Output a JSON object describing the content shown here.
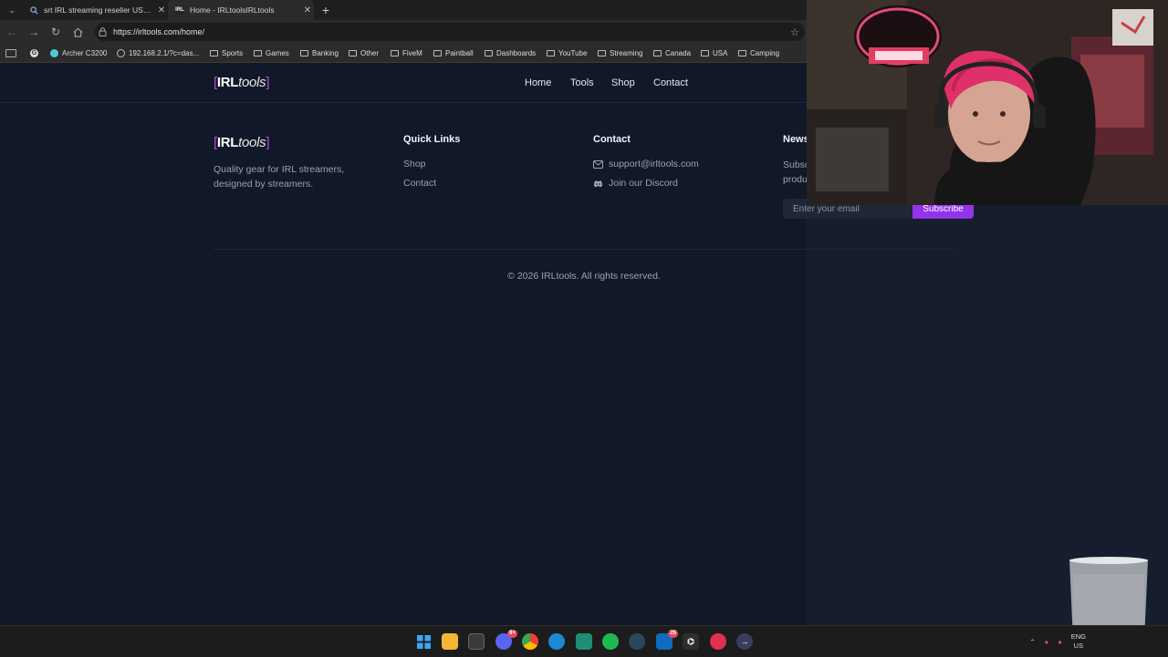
{
  "browser": {
    "tabs": [
      {
        "title": "srt IRL streaming reseller USA - Se",
        "icon": "search-icon",
        "active": false
      },
      {
        "title": "Home - IRLtoolsIRLtools",
        "icon": "irl-favicon",
        "active": true
      }
    ],
    "new_tab": "+",
    "url": "https://irltools.com/home/",
    "bookmarks": [
      {
        "label": "Archer C3200",
        "icon": "tp-link-icon"
      },
      {
        "label": "192.168.2.1/?c=das...",
        "icon": "globe-icon"
      },
      {
        "label": "Sports",
        "icon": "folder-icon"
      },
      {
        "label": "Games",
        "icon": "folder-icon"
      },
      {
        "label": "Banking",
        "icon": "folder-icon"
      },
      {
        "label": "Other",
        "icon": "folder-icon"
      },
      {
        "label": "FiveM",
        "icon": "folder-icon"
      },
      {
        "label": "Paintball",
        "icon": "folder-icon"
      },
      {
        "label": "Dashboards",
        "icon": "folder-icon"
      },
      {
        "label": "YouTube",
        "icon": "folder-icon"
      },
      {
        "label": "Streaming",
        "icon": "folder-icon"
      },
      {
        "label": "Canada",
        "icon": "folder-icon"
      },
      {
        "label": "USA",
        "icon": "folder-icon"
      },
      {
        "label": "Camping",
        "icon": "folder-icon"
      }
    ]
  },
  "site": {
    "logo": {
      "bracket_open": "[",
      "bold": "IRL",
      "italic": "tools",
      "bracket_close": "]"
    },
    "nav": [
      "Home",
      "Tools",
      "Shop",
      "Contact"
    ],
    "footer": {
      "tagline": "Quality gear for IRL streamers, designed by streamers.",
      "quick_links_title": "Quick Links",
      "quick_links": [
        "Shop",
        "Contact"
      ],
      "contact_title": "Contact",
      "email": "support@irltools.com",
      "discord": "Join our Discord",
      "newsletter_title": "News",
      "newsletter_text_1": "Subsc",
      "newsletter_text_2": "produ",
      "email_placeholder": "Enter your email",
      "subscribe_label": "Subscribe",
      "copyright": "© 2026 IRLtools. All rights reserved."
    }
  },
  "taskbar": {
    "apps": [
      "windows-start-icon",
      "file-explorer-icon",
      "store-icon",
      "discord-icon",
      "chrome-icon",
      "edge-icon",
      "terminal-icon",
      "spotify-icon",
      "steam-icon",
      "mail-icon",
      "game-icon",
      "app-icon",
      "arrow-app-icon"
    ],
    "badges": {
      "discord": "9+",
      "mail": "25"
    },
    "lang": "ENG",
    "region": "US"
  },
  "colors": {
    "accent": "#9333ea",
    "page_bg": "#111827",
    "chrome_bg": "#2b2b2b"
  }
}
